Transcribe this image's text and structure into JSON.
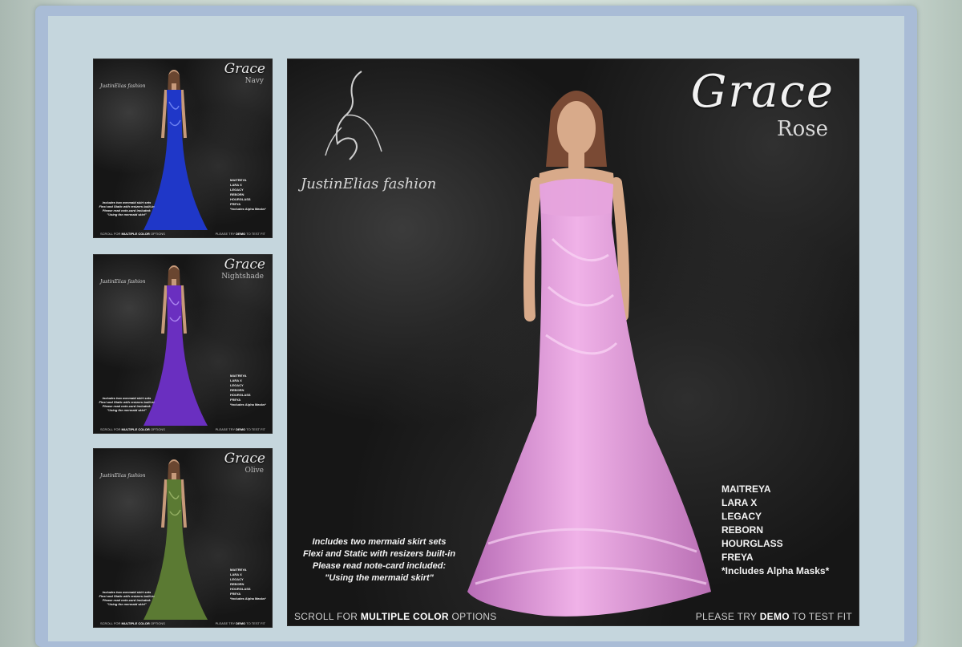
{
  "collection": "Grace",
  "brand": "JustinElias fashion",
  "thumbnails": [
    {
      "title": "Grace",
      "color": "Navy",
      "dress_color": "#1f37c8"
    },
    {
      "title": "Grace",
      "color": "Nightshade",
      "dress_color": "#6a2fc0"
    },
    {
      "title": "Grace",
      "color": "Olive",
      "dress_color": "#5b7a33"
    }
  ],
  "main": {
    "title": "Grace",
    "color": "Rose",
    "dress_color": "#d58ad0",
    "sizes": [
      "MAITREYA",
      "LARA X",
      "LEGACY",
      "REBORN",
      "HOURGLASS",
      "FREYA",
      "*Includes Alpha Masks*"
    ],
    "notes": [
      "Includes two mermaid skirt sets",
      "Flexi and Static with resizers built-in",
      "Please read note-card included:",
      "\"Using the mermaid skirt\""
    ],
    "footer_left": {
      "pre": "SCROLL FOR",
      "bold": "MULTIPLE COLOR",
      "post": "OPTIONS"
    },
    "footer_right": {
      "pre": "PLEASE TRY",
      "bold": "DEMO",
      "post": "TO TEST FIT"
    }
  }
}
